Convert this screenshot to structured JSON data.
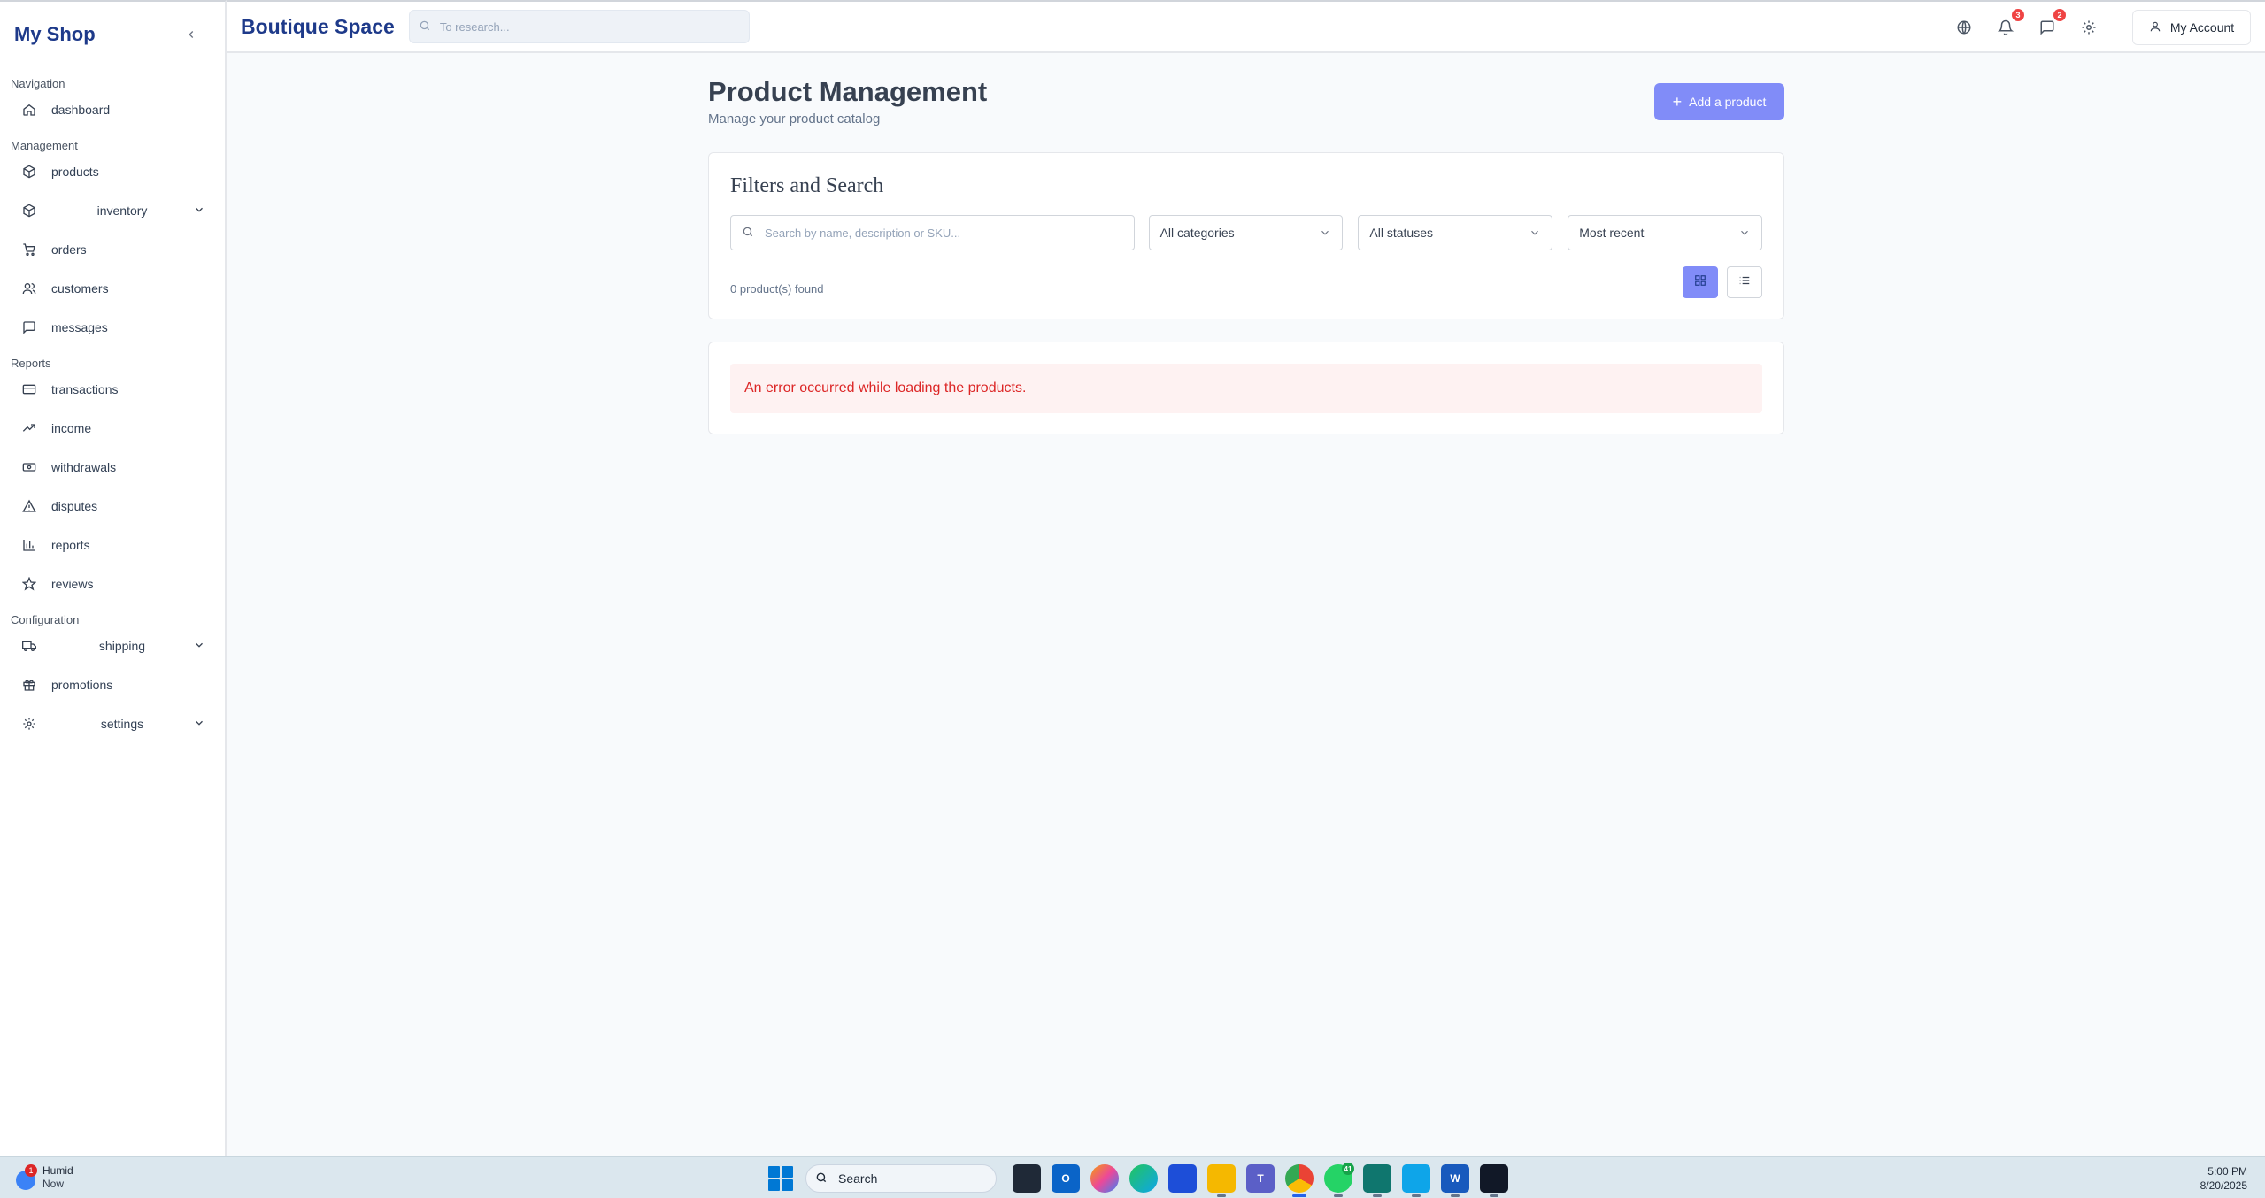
{
  "sidebar": {
    "title": "My Shop",
    "sections": {
      "navigation": "Navigation",
      "management": "Management",
      "reports": "Reports",
      "configuration": "Configuration"
    },
    "items": {
      "dashboard": "dashboard",
      "products": "products",
      "inventory": "inventory",
      "orders": "orders",
      "customers": "customers",
      "messages": "messages",
      "transactions": "transactions",
      "income": "income",
      "withdrawals": "withdrawals",
      "disputes": "disputes",
      "reports": "reports",
      "reviews": "reviews",
      "shipping": "shipping",
      "promotions": "promotions",
      "settings": "settings"
    }
  },
  "header": {
    "brand": "Boutique Space",
    "search_placeholder": "To research...",
    "notifications_count": "3",
    "messages_count": "2",
    "account_label": "My Account"
  },
  "main": {
    "title": "Product Management",
    "subtitle": "Manage your product catalog",
    "add_button": "Add a product",
    "filters": {
      "heading": "Filters and Search",
      "search_placeholder": "Search by name, description or SKU...",
      "category": "All categories",
      "status": "All statuses",
      "sort": "Most recent",
      "count_text": "0 product(s) found"
    },
    "error_message": "An error occurred while loading the products."
  },
  "taskbar": {
    "weather_label": "Humid",
    "weather_sub": "Now",
    "weather_badge": "1",
    "search_label": "Search",
    "whatsapp_badge": "41",
    "time": "5:00 PM",
    "date": "8/20/2025"
  },
  "colors": {
    "brand": "#1e3a8a",
    "accent": "#818cf8",
    "error": "#dc2626"
  }
}
